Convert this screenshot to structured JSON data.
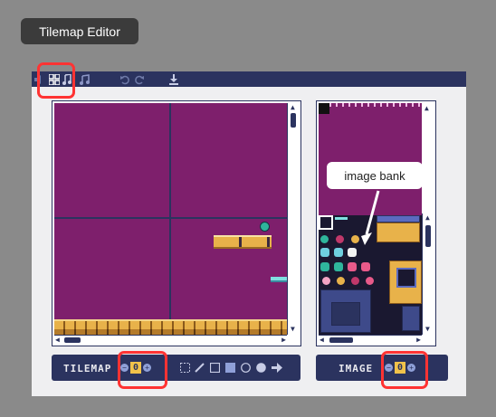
{
  "tooltip": {
    "text": "Tilemap Editor"
  },
  "toolbar": {
    "icons": [
      "sound-icon",
      "tilemap-icon",
      "music-icon",
      "undo-icon",
      "redo-icon",
      "download-icon"
    ]
  },
  "callout": {
    "text": "image bank"
  },
  "tilemap_bar": {
    "label": "TILEMAP",
    "value": "0"
  },
  "image_bar": {
    "label": "IMAGE",
    "value": "0"
  },
  "colors": {
    "toolbar": "#2b335f",
    "canvas": "#7e1f6c",
    "highlight": "#ff3333",
    "number_box": "#f1c24a"
  }
}
